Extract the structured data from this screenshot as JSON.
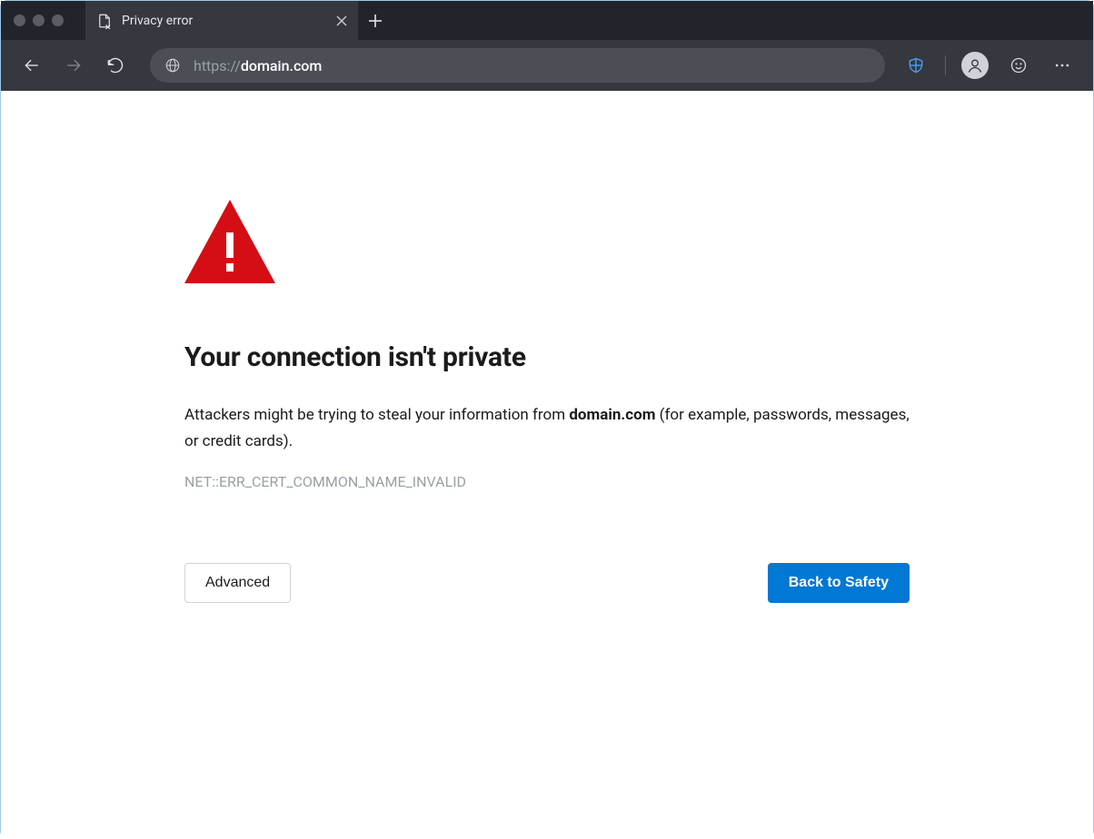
{
  "tab": {
    "title": "Privacy error"
  },
  "address_bar": {
    "scheme": "https://",
    "host": "domain.com",
    "full": "https://domain.com"
  },
  "interstitial": {
    "headline": "Your connection isn't private",
    "body_prefix": "Attackers might be trying to steal your information from ",
    "body_domain": "domain.com",
    "body_suffix": " (for example, passwords, messages, or credit cards).",
    "error_code": "NET::ERR_CERT_COMMON_NAME_INVALID",
    "advanced_label": "Advanced",
    "back_label": "Back to Safety"
  },
  "colors": {
    "danger": "#d40e14",
    "primary": "#0078d4"
  }
}
